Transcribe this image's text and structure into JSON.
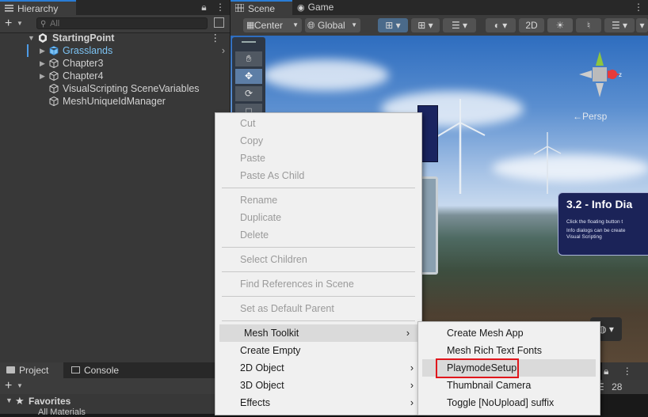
{
  "hierarchy": {
    "tab_label": "Hierarchy",
    "search_placeholder": "All",
    "root": "StartingPoint",
    "items": [
      "Grasslands",
      "Chapter3",
      "Chapter4",
      "VisualScripting SceneVariables",
      "MeshUniqueIdManager"
    ]
  },
  "bottom_panel": {
    "tab_project": "Project",
    "tab_console": "Console",
    "favorites": "Favorites",
    "favorite_item": "All Materials",
    "count": "28"
  },
  "scene": {
    "tab_scene": "Scene",
    "tab_game": "Game",
    "pivot_label": "Center",
    "space_label": "Global",
    "mode_2d": "2D",
    "persp_label": "Persp",
    "info_title": "3.2 - Info Dia",
    "info_line1": "Click the floating button t",
    "info_line2": "Info dialogs can be create",
    "info_line3": "Visual Scripting"
  },
  "context_menu": {
    "items": [
      {
        "label": "Cut",
        "disabled": true
      },
      {
        "label": "Copy",
        "disabled": true
      },
      {
        "label": "Paste",
        "disabled": true
      },
      {
        "label": "Paste As Child",
        "disabled": true
      },
      {
        "label": "Rename",
        "disabled": true
      },
      {
        "label": "Duplicate",
        "disabled": true
      },
      {
        "label": "Delete",
        "disabled": true
      },
      {
        "label": "Select Children",
        "disabled": true
      },
      {
        "label": "Find References in Scene",
        "disabled": true
      },
      {
        "label": "Set as Default Parent",
        "disabled": true
      },
      {
        "label": "Mesh Toolkit",
        "submenu": true
      },
      {
        "label": "Create Empty"
      },
      {
        "label": "2D Object",
        "submenu": true
      },
      {
        "label": "3D Object",
        "submenu": true
      },
      {
        "label": "Effects",
        "submenu": true
      }
    ]
  },
  "submenu": {
    "items": [
      "Create Mesh App",
      "Mesh Rich Text Fonts",
      "PlaymodeSetup",
      "Thumbnail Camera",
      "Toggle [NoUpload] suffix"
    ]
  }
}
